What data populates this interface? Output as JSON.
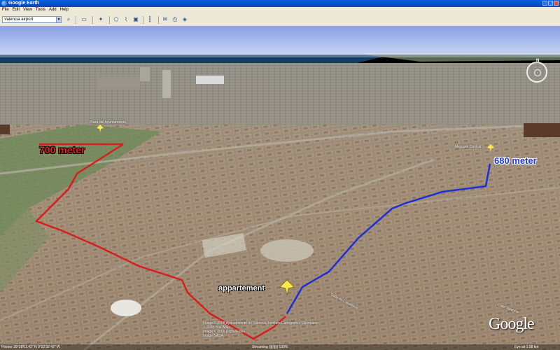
{
  "window": {
    "title": "Google Earth"
  },
  "menu": [
    "File",
    "Edit",
    "View",
    "Tools",
    "Add",
    "Help"
  ],
  "search": {
    "value": "Valencia airport"
  },
  "map": {
    "route_red_label": "700 meter",
    "route_blue_label": "680 meter",
    "placemark_label": "appartement",
    "small_label_left": "Plaza del Ayuntamiento",
    "small_label_right": "Mercado Central",
    "street_label_1": "Calle de Caballeros",
    "street_label_2": "Calle Valencia"
  },
  "copyright": [
    "Image © 2008 Ayuntamiento de Valencia, Instituto Cartografico Valenciano",
    "© 2008 Tele Atlas",
    "Image © 2008 DigitalGlobe",
    "Image NASA"
  ],
  "logo": "Google",
  "status": {
    "pointer": "Pointer 39°28'01.42\" N 0°22'32.42\" W",
    "streaming": "Streaming |||||||||| 100%",
    "elevation": "Eye alt 1.58 km"
  },
  "colors": {
    "route_red": "#d81e1e",
    "route_blue": "#1f2fd8",
    "sky": "#9fb3ea",
    "sea": "#103e66"
  }
}
